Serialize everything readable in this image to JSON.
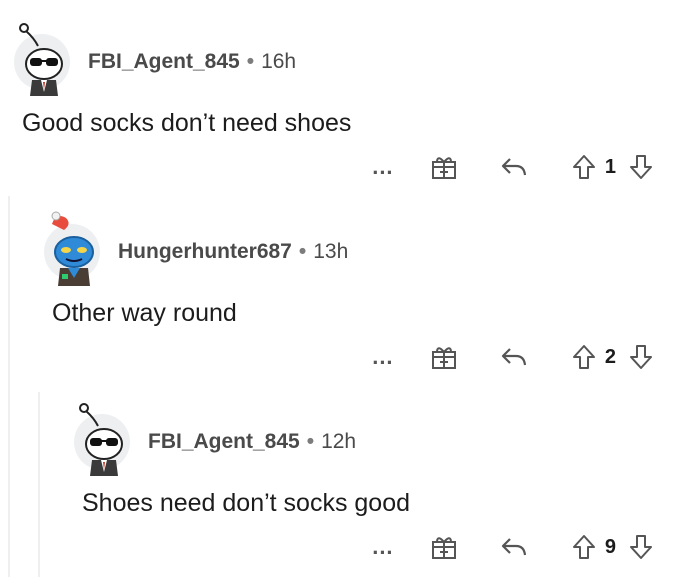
{
  "comments": [
    {
      "username": "FBI_Agent_845",
      "separator": "•",
      "age": "16h",
      "text": "Good socks don’t need shoes",
      "more": "...",
      "votes": "1",
      "avatar": "sunglasses-snoo-avatar"
    },
    {
      "username": "Hungerhunter687",
      "separator": "•",
      "age": "13h",
      "text": "Other way round",
      "more": "...",
      "votes": "2",
      "avatar": "blue-snoo-avatar"
    },
    {
      "username": "FBI_Agent_845",
      "separator": "•",
      "age": "12h",
      "text": "Shoes need don’t socks good",
      "more": "...",
      "votes": "9",
      "avatar": "sunglasses-snoo-avatar"
    }
  ],
  "icons": {
    "gift": "gift-award-icon",
    "reply": "reply-arrow-icon",
    "upvote": "upvote-arrow-icon",
    "downvote": "downvote-arrow-icon"
  },
  "colors": {
    "thread_line": "#edeff1",
    "username": "#4a4a4a",
    "avatar_bg": "#edeff1",
    "blue_snoo": "#2f8ad8"
  }
}
